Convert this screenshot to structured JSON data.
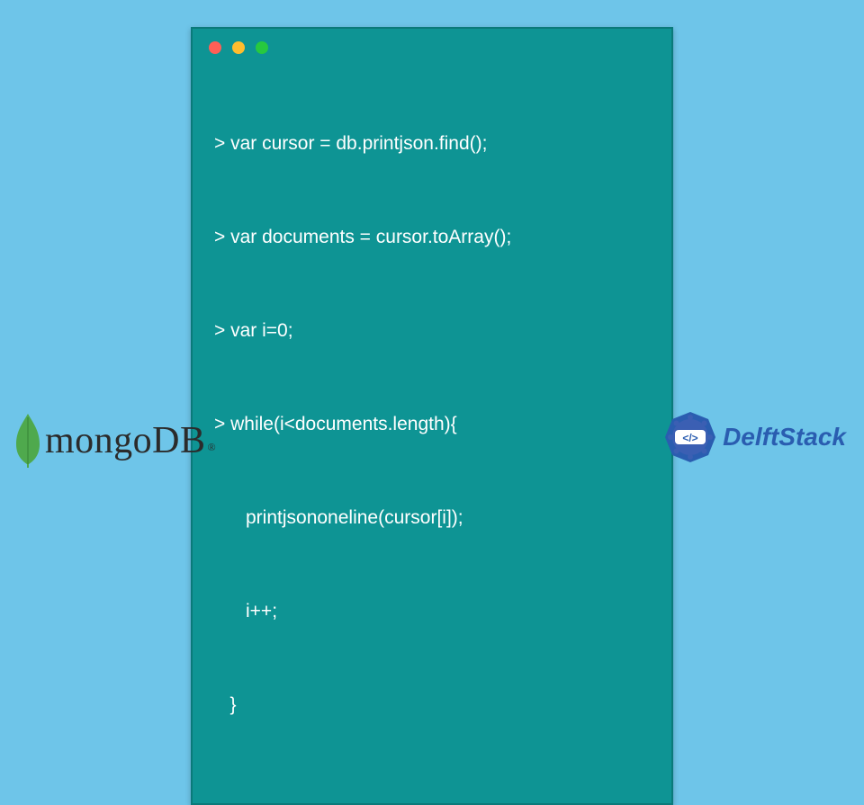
{
  "code": {
    "lines": [
      "> var cursor = db.printjson.find();",
      "> var documents = cursor.toArray();",
      "> var i=0;",
      "> while(i<documents.length){",
      "      printjsononeline(cursor[i]);",
      "      i++;",
      "   }"
    ]
  },
  "brand_left": {
    "name": "mongoDB",
    "registered": "®"
  },
  "brand_right": {
    "name": "DelftStack"
  },
  "colors": {
    "background": "#6ec5e9",
    "window": "#0e9494",
    "code_text": "#ffffff",
    "leaf": "#4fa94d",
    "delft_blue": "#2a5db0"
  }
}
